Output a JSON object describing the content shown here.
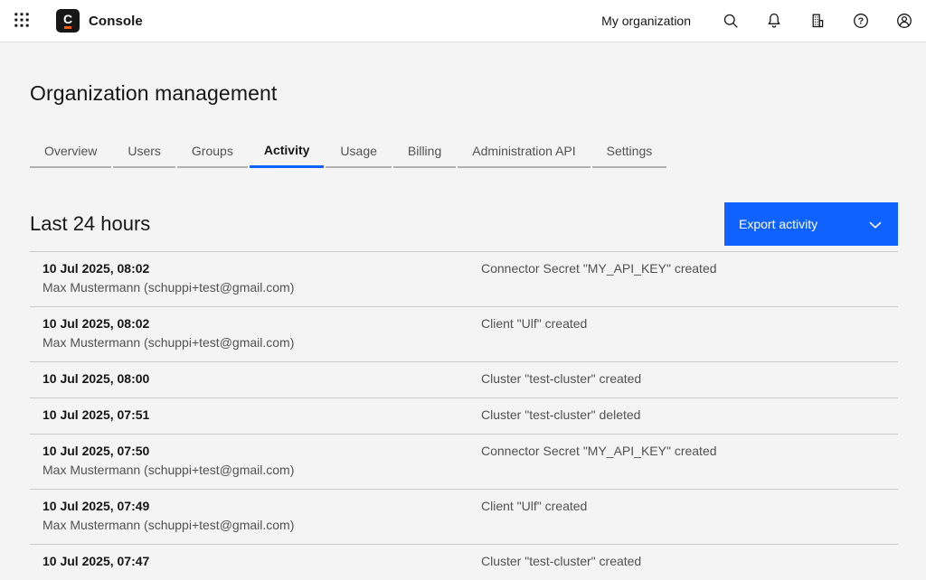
{
  "header": {
    "app_name": "Console",
    "org_name": "My organization",
    "icons": {
      "app_switcher": "3x3-dot-grid",
      "search": "magnifier",
      "notifications": "bell",
      "organizations": "building",
      "help": "question-mark-circle",
      "profile": "person-circle"
    }
  },
  "page_title": "Organization management",
  "tabs": [
    "Overview",
    "Users",
    "Groups",
    "Activity",
    "Usage",
    "Billing",
    "Administration API",
    "Settings"
  ],
  "active_tab": "Activity",
  "section": {
    "heading": "Last 24 hours",
    "export_button_label": "Export activity",
    "export_button_icon": "chevron-down"
  },
  "activity_rows": [
    {
      "timestamp": "10 Jul 2025, 08:02",
      "user": "Max Mustermann (schuppi+test@gmail.com)",
      "event": "Connector Secret \"MY_API_KEY\" created"
    },
    {
      "timestamp": "10 Jul 2025, 08:02",
      "user": "Max Mustermann (schuppi+test@gmail.com)",
      "event": "Client \"Ulf\" created"
    },
    {
      "timestamp": "10 Jul 2025, 08:00",
      "user": "",
      "event": "Cluster \"test-cluster\" created"
    },
    {
      "timestamp": "10 Jul 2025, 07:51",
      "user": "",
      "event": "Cluster \"test-cluster\" deleted"
    },
    {
      "timestamp": "10 Jul 2025, 07:50",
      "user": "Max Mustermann (schuppi+test@gmail.com)",
      "event": "Connector Secret \"MY_API_KEY\" created"
    },
    {
      "timestamp": "10 Jul 2025, 07:49",
      "user": "Max Mustermann (schuppi+test@gmail.com)",
      "event": "Client \"Ulf\" created"
    },
    {
      "timestamp": "10 Jul 2025, 07:47",
      "user": "",
      "event": "Cluster \"test-cluster\" created"
    }
  ],
  "colors": {
    "accent_blue": "#0f62fe",
    "logo_black": "#161616",
    "logo_orange": "#fc5d0d",
    "page_background": "#f4f4f4",
    "header_background": "#ffffff"
  }
}
